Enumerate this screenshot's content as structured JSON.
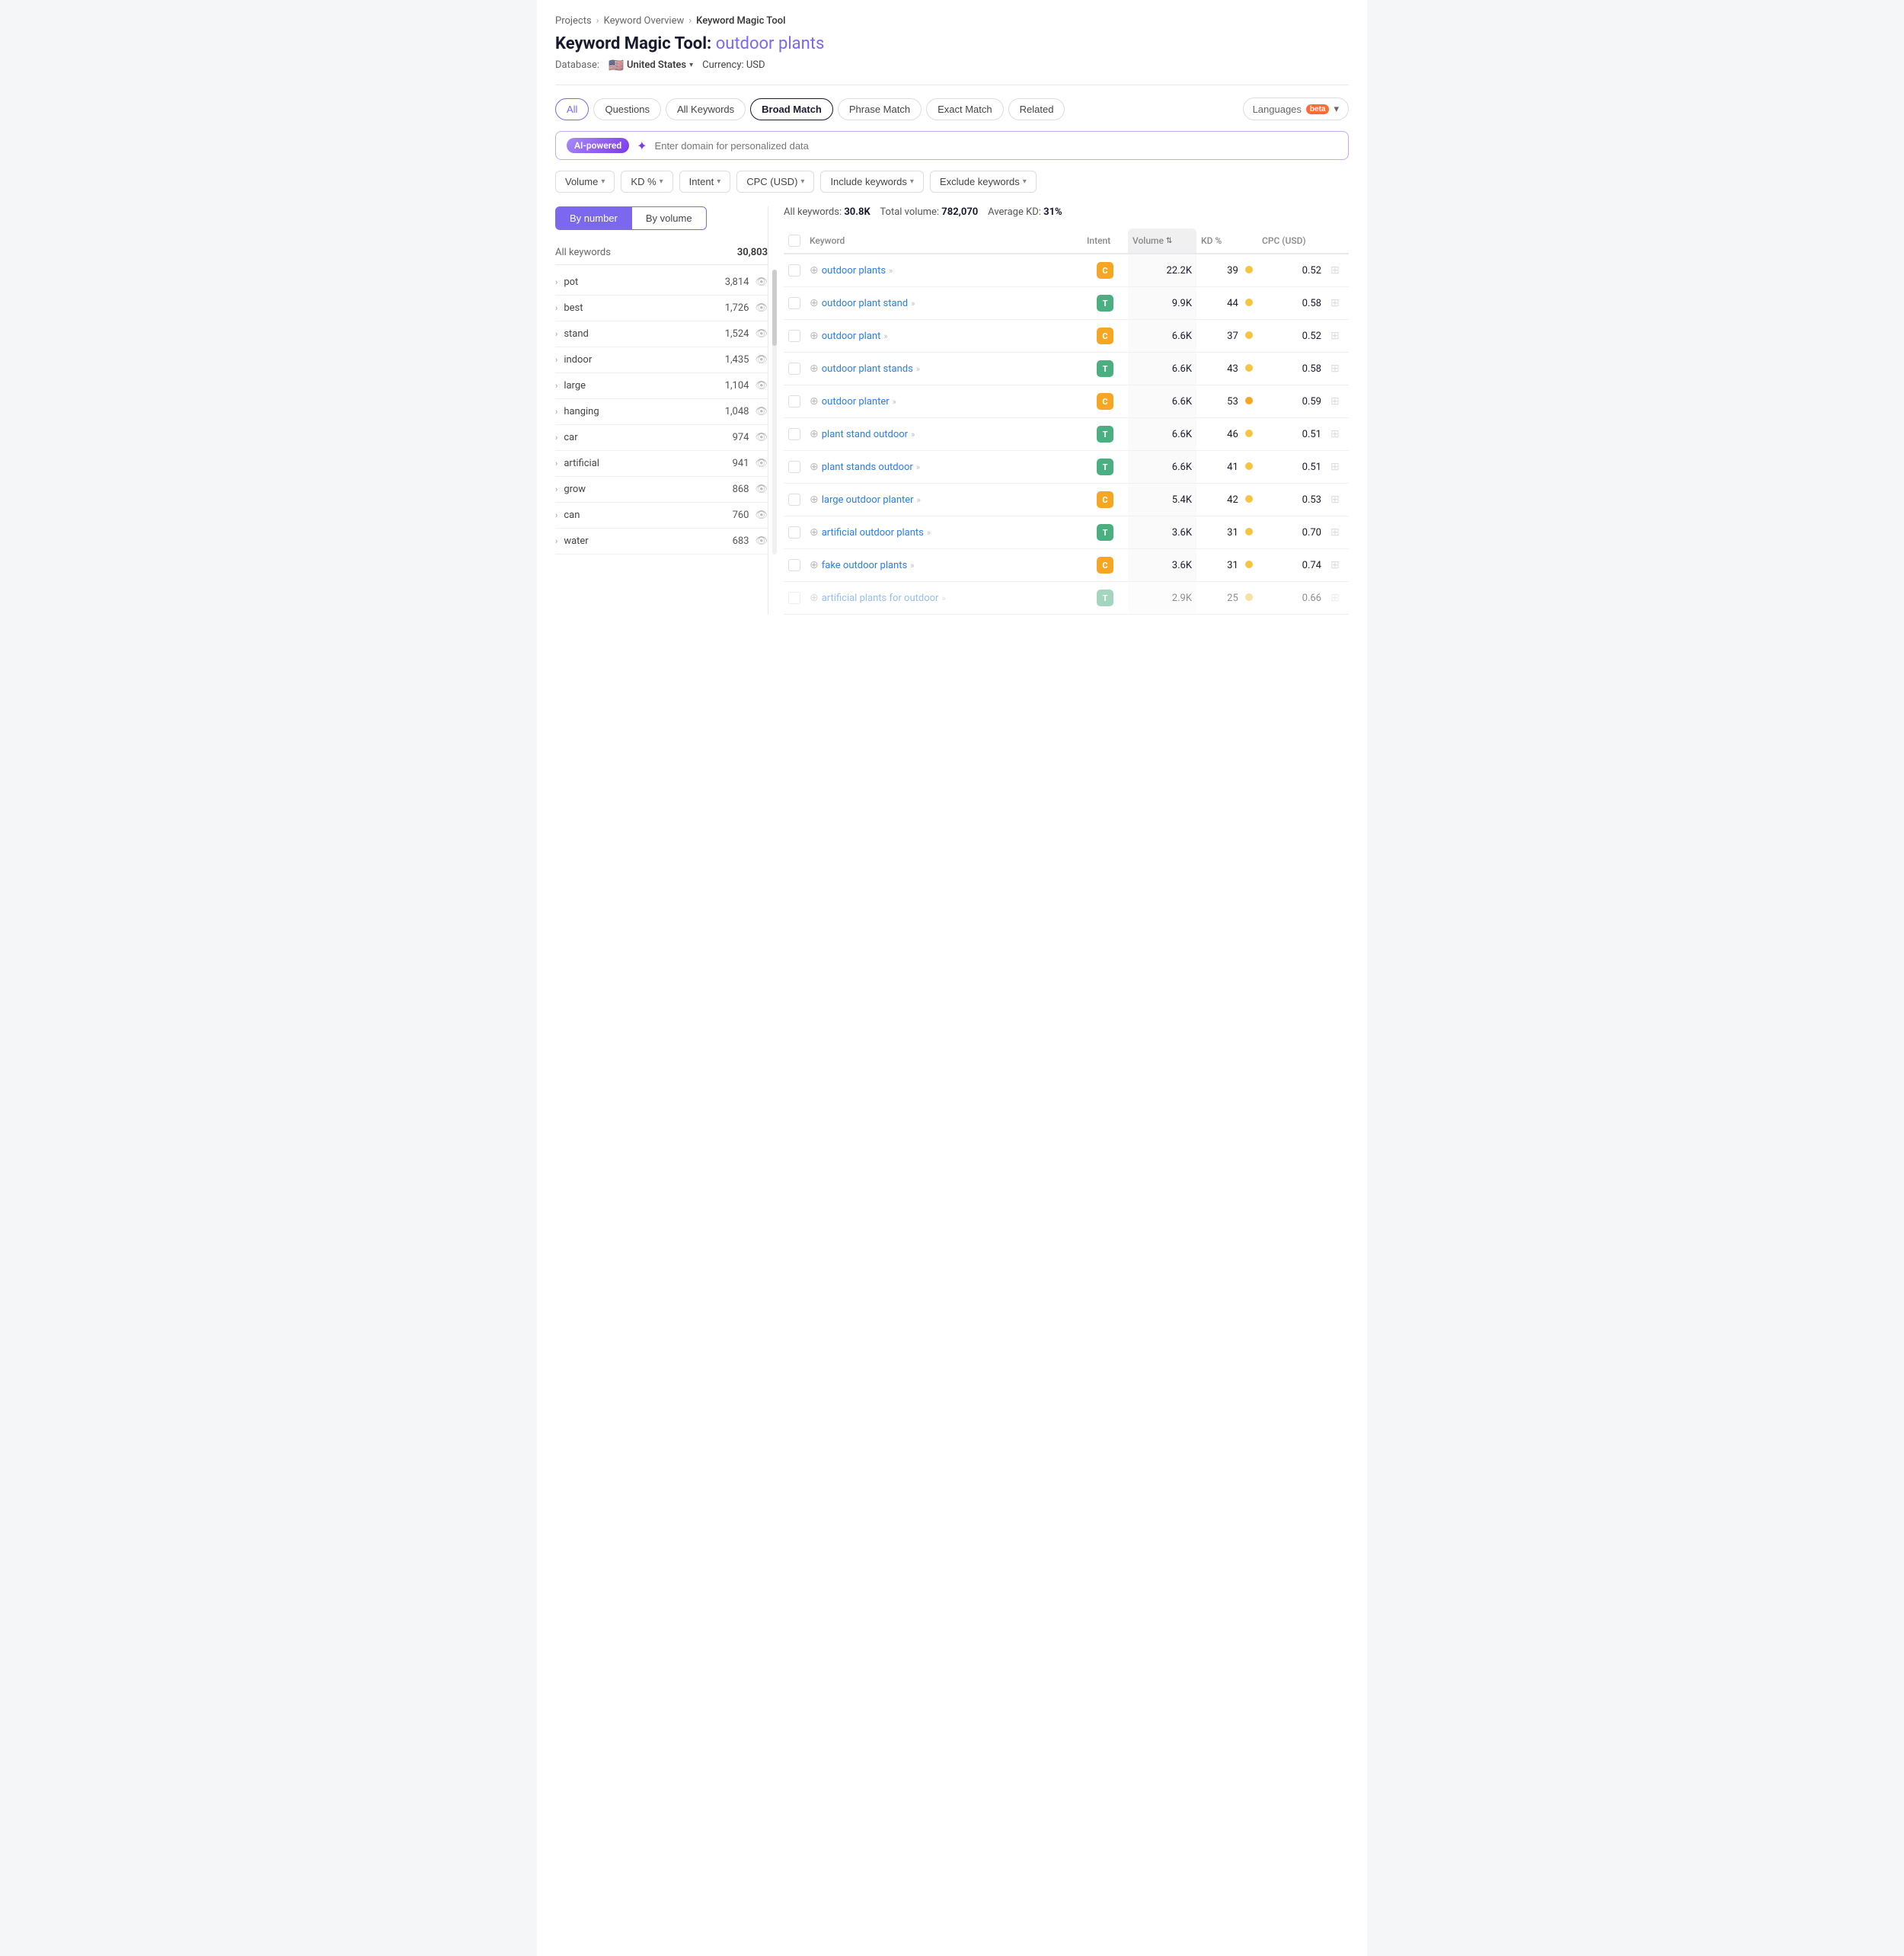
{
  "breadcrumb": {
    "items": [
      "Projects",
      "Keyword Overview",
      "Keyword Magic Tool"
    ]
  },
  "page": {
    "title_prefix": "Keyword Magic Tool:",
    "query": "outdoor plants",
    "db_label": "Database:",
    "db_value": "United States",
    "currency_label": "Currency: USD"
  },
  "tabs": [
    {
      "id": "all",
      "label": "All",
      "active": true
    },
    {
      "id": "questions",
      "label": "Questions",
      "active": false
    },
    {
      "id": "all-keywords",
      "label": "All Keywords",
      "active": false
    },
    {
      "id": "broad-match",
      "label": "Broad Match",
      "active": true
    },
    {
      "id": "phrase-match",
      "label": "Phrase Match",
      "active": false
    },
    {
      "id": "exact-match",
      "label": "Exact Match",
      "active": false
    },
    {
      "id": "related",
      "label": "Related",
      "active": false
    }
  ],
  "languages_btn": "Languages",
  "beta_label": "beta",
  "ai_bar": {
    "badge": "AI-powered",
    "placeholder": "Enter domain for personalized data"
  },
  "filters": [
    {
      "id": "volume",
      "label": "Volume"
    },
    {
      "id": "kd",
      "label": "KD %"
    },
    {
      "id": "intent",
      "label": "Intent"
    },
    {
      "id": "cpc",
      "label": "CPC (USD)"
    },
    {
      "id": "include",
      "label": "Include keywords"
    },
    {
      "id": "exclude",
      "label": "Exclude keywords"
    }
  ],
  "sidebar": {
    "toggle_by_number": "By number",
    "toggle_by_volume": "By volume",
    "header_label": "All keywords",
    "header_count": "30,803",
    "items": [
      {
        "label": "pot",
        "count": "3,814"
      },
      {
        "label": "best",
        "count": "1,726"
      },
      {
        "label": "stand",
        "count": "1,524"
      },
      {
        "label": "indoor",
        "count": "1,435"
      },
      {
        "label": "large",
        "count": "1,104"
      },
      {
        "label": "hanging",
        "count": "1,048"
      },
      {
        "label": "car",
        "count": "974"
      },
      {
        "label": "artificial",
        "count": "941"
      },
      {
        "label": "grow",
        "count": "868"
      },
      {
        "label": "can",
        "count": "760"
      },
      {
        "label": "water",
        "count": "683"
      }
    ]
  },
  "stats": {
    "all_keywords_label": "All keywords:",
    "all_keywords_value": "30.8K",
    "total_volume_label": "Total volume:",
    "total_volume_value": "782,070",
    "avg_kd_label": "Average KD:",
    "avg_kd_value": "31%"
  },
  "table": {
    "headers": {
      "keyword": "Keyword",
      "intent": "Intent",
      "volume": "Volume",
      "kd": "KD %",
      "cpc": "CPC (USD)"
    },
    "rows": [
      {
        "keyword": "outdoor plants",
        "intent": "C",
        "intent_color": "c",
        "volume": "22.2K",
        "kd": 39,
        "kd_color": "yellow",
        "cpc": "0.52"
      },
      {
        "keyword": "outdoor plant stand",
        "intent": "T",
        "intent_color": "t",
        "volume": "9.9K",
        "kd": 44,
        "kd_color": "yellow",
        "cpc": "0.58"
      },
      {
        "keyword": "outdoor plant",
        "intent": "C",
        "intent_color": "c",
        "volume": "6.6K",
        "kd": 37,
        "kd_color": "yellow",
        "cpc": "0.52"
      },
      {
        "keyword": "outdoor plant stands",
        "intent": "T",
        "intent_color": "t",
        "volume": "6.6K",
        "kd": 43,
        "kd_color": "yellow",
        "cpc": "0.58"
      },
      {
        "keyword": "outdoor planter",
        "intent": "C",
        "intent_color": "c",
        "volume": "6.6K",
        "kd": 53,
        "kd_color": "orange",
        "cpc": "0.59"
      },
      {
        "keyword": "plant stand outdoor",
        "intent": "T",
        "intent_color": "t",
        "volume": "6.6K",
        "kd": 46,
        "kd_color": "yellow",
        "cpc": "0.51"
      },
      {
        "keyword": "plant stands outdoor",
        "intent": "T",
        "intent_color": "t",
        "volume": "6.6K",
        "kd": 41,
        "kd_color": "yellow",
        "cpc": "0.51"
      },
      {
        "keyword": "large outdoor planter",
        "intent": "C",
        "intent_color": "c",
        "volume": "5.4K",
        "kd": 42,
        "kd_color": "yellow",
        "cpc": "0.53"
      },
      {
        "keyword": "artificial outdoor plants",
        "intent": "T",
        "intent_color": "t",
        "volume": "3.6K",
        "kd": 31,
        "kd_color": "yellow",
        "cpc": "0.70"
      },
      {
        "keyword": "fake outdoor plants",
        "intent": "C",
        "intent_color": "c",
        "volume": "3.6K",
        "kd": 31,
        "kd_color": "yellow",
        "cpc": "0.74"
      },
      {
        "keyword": "artificial plants for outdoor",
        "intent": "T",
        "intent_color": "t",
        "volume": "2.9K",
        "kd": 25,
        "kd_color": "yellow",
        "cpc": "0.66",
        "partial": true
      }
    ]
  }
}
